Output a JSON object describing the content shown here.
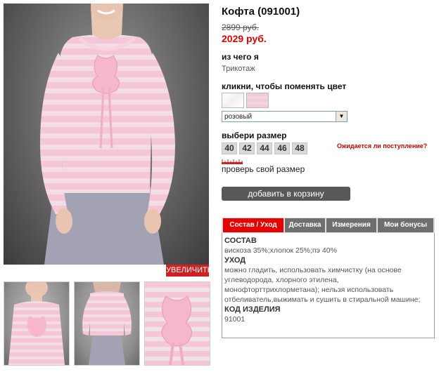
{
  "product": {
    "title": "Кофта (091001)",
    "old_price": "2899 руб.",
    "new_price": "2029 руб."
  },
  "material": {
    "label": "из чего я",
    "value": "Трикотаж"
  },
  "color": {
    "label": "кликни, чтобы поменять цвет",
    "swatches": [
      "white",
      "pink"
    ],
    "selected": "розовый"
  },
  "sizes": {
    "label": "выбери размер",
    "values": [
      "40",
      "42",
      "44",
      "46",
      "48"
    ],
    "waiting_link": "Ожидается ли поступление?"
  },
  "check_size": "проверь свой размер",
  "cart_button": "добавить в корзину",
  "zoom_button": "УВЕЛИЧИТЬ",
  "tabs": [
    {
      "label": "Состав / Уход",
      "active": true
    },
    {
      "label": "Доставка",
      "active": false
    },
    {
      "label": "Измерения",
      "active": false
    },
    {
      "label": "Мои бонусы",
      "active": false
    }
  ],
  "tab_content": {
    "composition_heading": "СОСТАВ",
    "composition": "вискоза 35%;хлопок 25%;пэ 40%",
    "care_heading": "УХОД",
    "care": "можно гладить, использовать химчистку (на основе углеводорода, хлорного этилена, монофторттрихлорметана); нельзя использовать отбеливатель,выжимать и сушить в стиральной машине;",
    "code_heading": "КОД ИЗДЕЛИЯ",
    "code": "91001"
  },
  "colors": {
    "accent_red": "#e60000",
    "tab_gray": "#6f6f6f",
    "cart_gray": "#585858",
    "blouse_pink": "#f3c3d3"
  }
}
